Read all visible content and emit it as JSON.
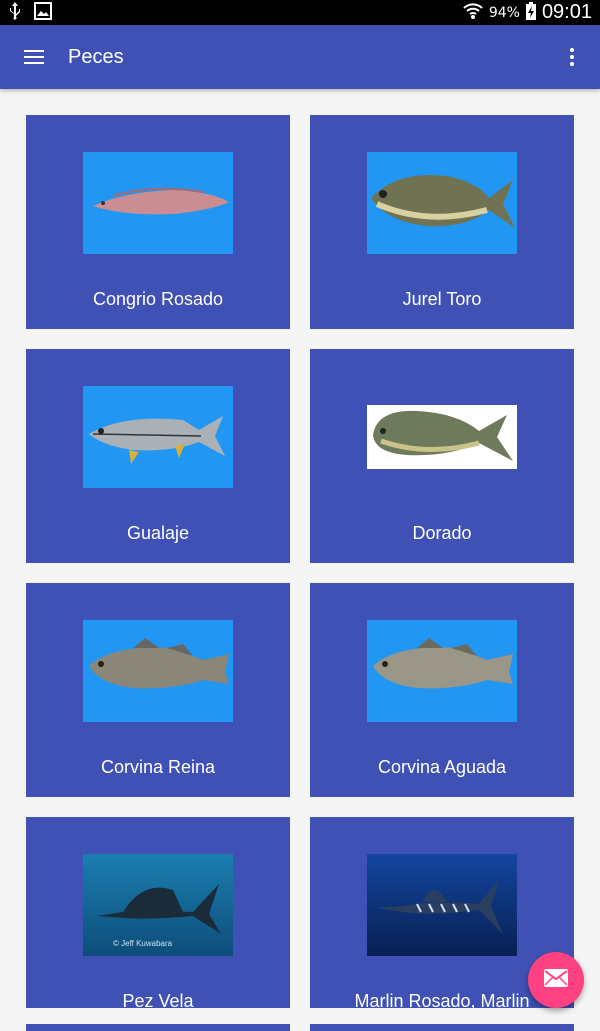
{
  "status_bar": {
    "battery": "94%",
    "time": "09:01",
    "icons": [
      "usb-icon",
      "image-icon",
      "wifi-icon",
      "battery-charging-icon"
    ]
  },
  "app_bar": {
    "title": "Peces",
    "menu_icon": "hamburger-menu-icon",
    "overflow_icon": "more-vert-icon"
  },
  "fish": [
    {
      "name": "Congrio Rosado"
    },
    {
      "name": "Jurel Toro"
    },
    {
      "name": "Gualaje"
    },
    {
      "name": "Dorado"
    },
    {
      "name": "Corvina Reina"
    },
    {
      "name": "Corvina Aguada"
    },
    {
      "name": "Pez Vela",
      "image_caption": "© Jeff Kuwabara"
    },
    {
      "name": "Marlin Rosado, Marlin"
    }
  ],
  "fab": {
    "icon": "mail-icon"
  },
  "colors": {
    "primary": "#3f51b5",
    "accent": "#ff4081",
    "thumb_background": "#2196f3"
  }
}
